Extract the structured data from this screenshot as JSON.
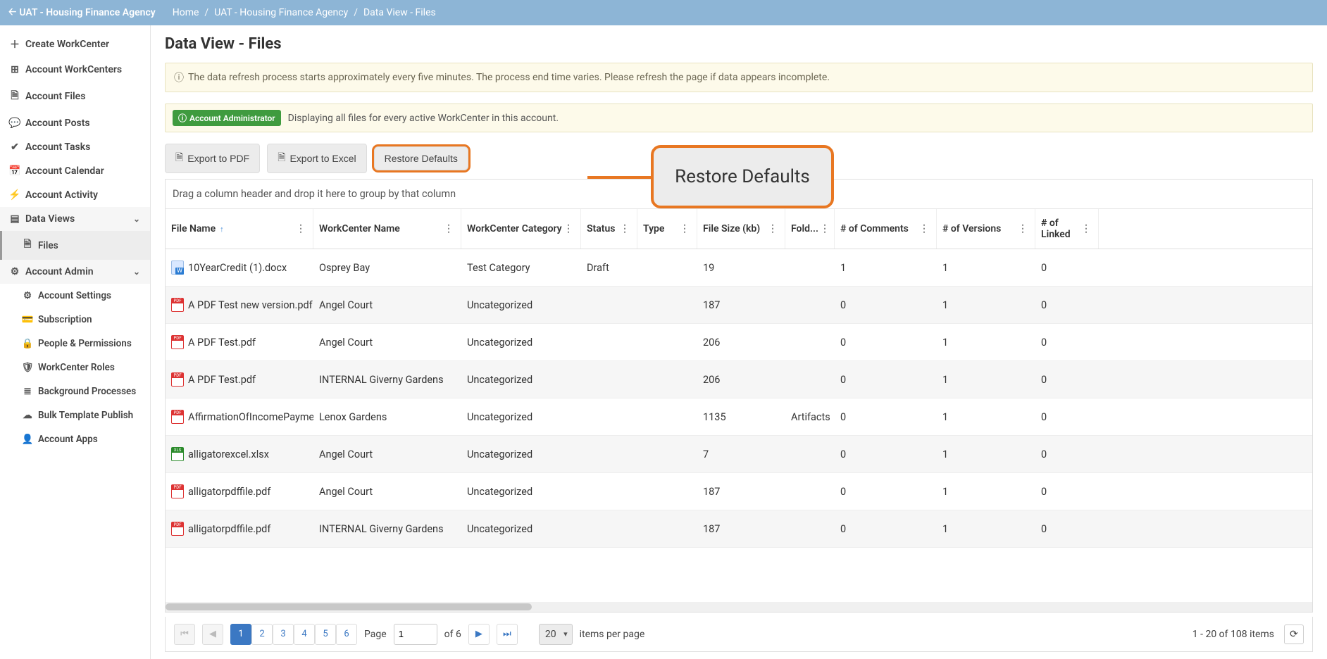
{
  "topbar": {
    "back_label": "UAT - Housing Finance Agency",
    "crumbs": [
      "Home",
      "UAT - Housing Finance Agency",
      "Data View - Files"
    ]
  },
  "sidebar": {
    "create_label": "Create WorkCenter",
    "items": [
      {
        "icon": "grid",
        "label": "Account WorkCenters"
      },
      {
        "icon": "file",
        "label": "Account Files"
      },
      {
        "icon": "chat",
        "label": "Account Posts"
      },
      {
        "icon": "check",
        "label": "Account Tasks"
      },
      {
        "icon": "cal",
        "label": "Account Calendar"
      },
      {
        "icon": "bolt",
        "label": "Account Activity"
      }
    ],
    "dataviews": {
      "label": "Data Views",
      "child": "Files"
    },
    "admin": {
      "label": "Account Admin",
      "children": [
        {
          "icon": "gear",
          "label": "Account Settings"
        },
        {
          "icon": "card",
          "label": "Subscription"
        },
        {
          "icon": "lock",
          "label": "People & Permissions"
        },
        {
          "icon": "shield",
          "label": "WorkCenter Roles"
        },
        {
          "icon": "list",
          "label": "Background Processes"
        },
        {
          "icon": "cloud",
          "label": "Bulk Template Publish"
        },
        {
          "icon": "user",
          "label": "Account Apps"
        }
      ]
    }
  },
  "page": {
    "title": "Data View - Files",
    "info_text": "The data refresh process starts approximately every five minutes. The process end time varies. Please refresh the page if data appears incomplete.",
    "admin_badge": "Account Administrator",
    "admin_text": "Displaying all files for every active WorkCenter in this account.",
    "export_pdf": "Export to PDF",
    "export_excel": "Export to Excel",
    "restore": "Restore Defaults",
    "callout": "Restore Defaults",
    "group_hint": "Drag a column header and drop it here to group by that column"
  },
  "columns": [
    "File Name",
    "WorkCenter Name",
    "WorkCenter Category",
    "Status",
    "Type",
    "File Size (kb)",
    "Fold...",
    "# of Comments",
    "# of Versions",
    "# of Linked"
  ],
  "rows": [
    {
      "icon": "docx",
      "file": "10YearCredit (1).docx",
      "wc": "Osprey Bay",
      "cat": "Test Category",
      "status": "Draft",
      "type": "",
      "size": "19",
      "folder": "",
      "comments": "1",
      "versions": "1",
      "linked": "0"
    },
    {
      "icon": "pdf",
      "file": "A PDF Test new version.pdf",
      "wc": "Angel Court",
      "cat": "Uncategorized",
      "status": "",
      "type": "",
      "size": "187",
      "folder": "",
      "comments": "0",
      "versions": "1",
      "linked": "0"
    },
    {
      "icon": "pdf",
      "file": "A PDF Test.pdf",
      "wc": "Angel Court",
      "cat": "Uncategorized",
      "status": "",
      "type": "",
      "size": "206",
      "folder": "",
      "comments": "0",
      "versions": "1",
      "linked": "0"
    },
    {
      "icon": "pdf",
      "file": "A PDF Test.pdf",
      "wc": "INTERNAL Giverny Gardens",
      "cat": "Uncategorized",
      "status": "",
      "type": "",
      "size": "206",
      "folder": "",
      "comments": "0",
      "versions": "1",
      "linked": "0"
    },
    {
      "icon": "pdf",
      "file": "AffirmationOfIncomePayments....",
      "wc": "Lenox Gardens",
      "cat": "Uncategorized",
      "status": "",
      "type": "",
      "size": "1135",
      "folder": "Artifacts",
      "comments": "0",
      "versions": "1",
      "linked": "0"
    },
    {
      "icon": "xlsx",
      "file": "alligatorexcel.xlsx",
      "wc": "Angel Court",
      "cat": "Uncategorized",
      "status": "",
      "type": "",
      "size": "7",
      "folder": "",
      "comments": "0",
      "versions": "1",
      "linked": "0"
    },
    {
      "icon": "pdf",
      "file": "alligatorpdffile.pdf",
      "wc": "Angel Court",
      "cat": "Uncategorized",
      "status": "",
      "type": "",
      "size": "187",
      "folder": "",
      "comments": "0",
      "versions": "1",
      "linked": "0"
    },
    {
      "icon": "pdf",
      "file": "alligatorpdffile.pdf",
      "wc": "INTERNAL Giverny Gardens",
      "cat": "Uncategorized",
      "status": "",
      "type": "",
      "size": "187",
      "folder": "",
      "comments": "0",
      "versions": "1",
      "linked": "0"
    }
  ],
  "pager": {
    "pages": [
      "1",
      "2",
      "3",
      "4",
      "5",
      "6"
    ],
    "page_label": "Page",
    "current": "1",
    "of_label": "of 6",
    "per_page": "20",
    "per_page_label": "items per page",
    "summary": "1 - 20 of 108 items"
  }
}
